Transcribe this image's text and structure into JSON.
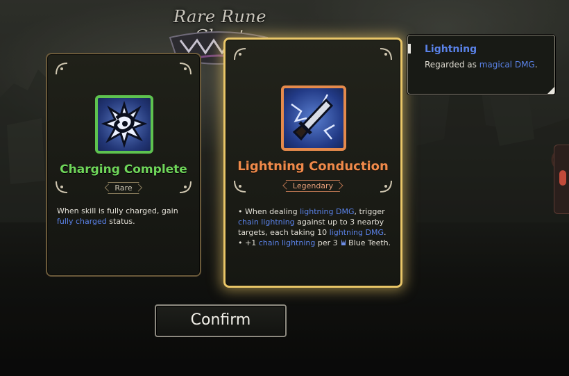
{
  "title": "Rare Rune Chest",
  "cards": [
    {
      "name": "Charging Complete",
      "rarity": "Rare",
      "icon": "lightning-burst-rune-icon",
      "description_parts": [
        "When skill is fully charged, gain ",
        "fully charged",
        " status."
      ],
      "colors": {
        "name": "#6fd65a",
        "frame": "#5ec24f"
      }
    },
    {
      "name": "Lightning Conduction",
      "rarity": "Legendary",
      "icon": "lightning-dagger-rune-icon",
      "selected": true,
      "description_lines": [
        {
          "parts": [
            "• When dealing ",
            "lightning DMG",
            ", trigger ",
            "chain lightning",
            " against up to 3 nearby targets, each taking 10 ",
            "lightning DMG",
            "."
          ]
        },
        {
          "parts": [
            "• +1 ",
            "chain lightning",
            " per 3 ",
            "Blue Teeth."
          ]
        }
      ],
      "colors": {
        "name": "#f08a4a",
        "frame": "#e58a4c",
        "glow": "#e9c668"
      }
    }
  ],
  "tooltip": {
    "title": "Lightning",
    "text_parts": [
      "Regarded as ",
      "magical DMG",
      "."
    ]
  },
  "confirm_label": "Confirm",
  "colors": {
    "highlight": "#5a82e8",
    "background": "#1a1c18"
  }
}
